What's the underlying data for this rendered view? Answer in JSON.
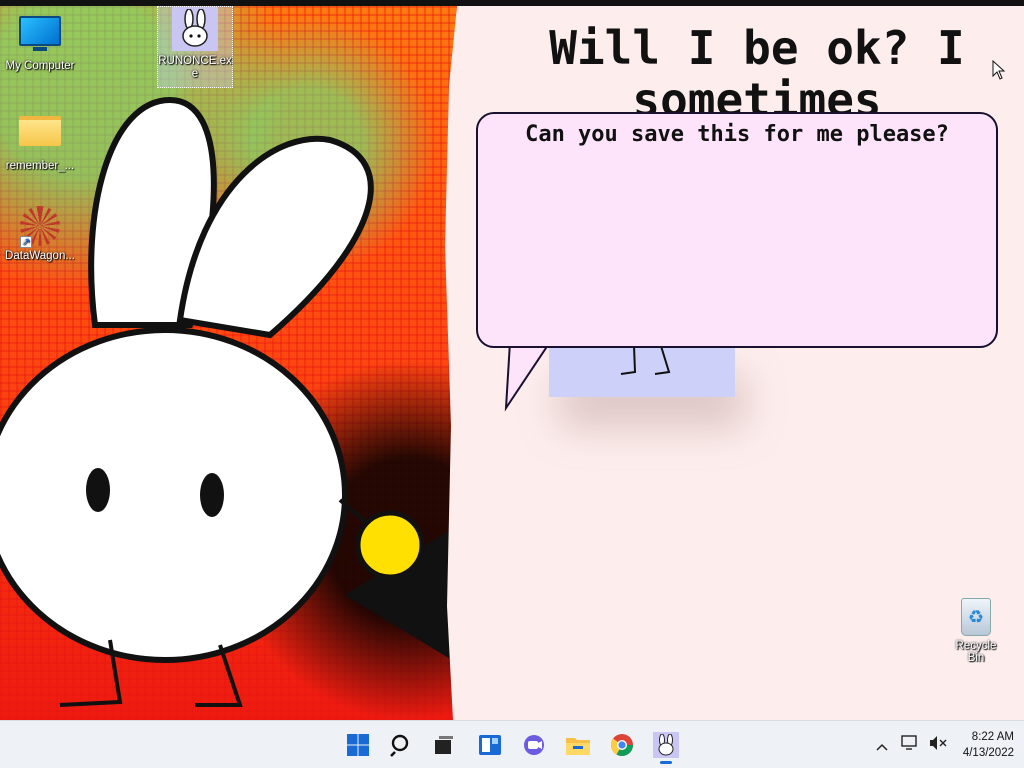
{
  "desktop": {
    "icons": [
      {
        "label": "My Computer"
      },
      {
        "label": "RUNONCE.exe"
      },
      {
        "label": "remember_..."
      },
      {
        "label": "DataWagon..."
      }
    ],
    "recycle_bin": {
      "label": "Recycle Bin"
    }
  },
  "app_window": {
    "heading": "Will I be ok? I sometimes wonder...",
    "speech_bubble": "Can you save this for me please?"
  },
  "taskbar": {
    "items": [
      {
        "icon": "windows-start-icon"
      },
      {
        "icon": "search-icon"
      },
      {
        "icon": "task-view-icon"
      },
      {
        "icon": "widgets-icon"
      },
      {
        "icon": "chat-icon"
      },
      {
        "icon": "file-explorer-icon"
      },
      {
        "icon": "chrome-icon"
      },
      {
        "icon": "bunny-app-icon"
      }
    ],
    "tray": {
      "time": "8:22 AM",
      "date": "4/13/2022"
    }
  },
  "colors": {
    "desktop_orange": "#ff5a0a",
    "window_bg": "#fdeeed",
    "bubble_bg": "#fde4fb",
    "card_bg": "#cdd0f8",
    "taskbar_bg": "#eef2f7",
    "accent_blue": "#1a6ad6"
  }
}
